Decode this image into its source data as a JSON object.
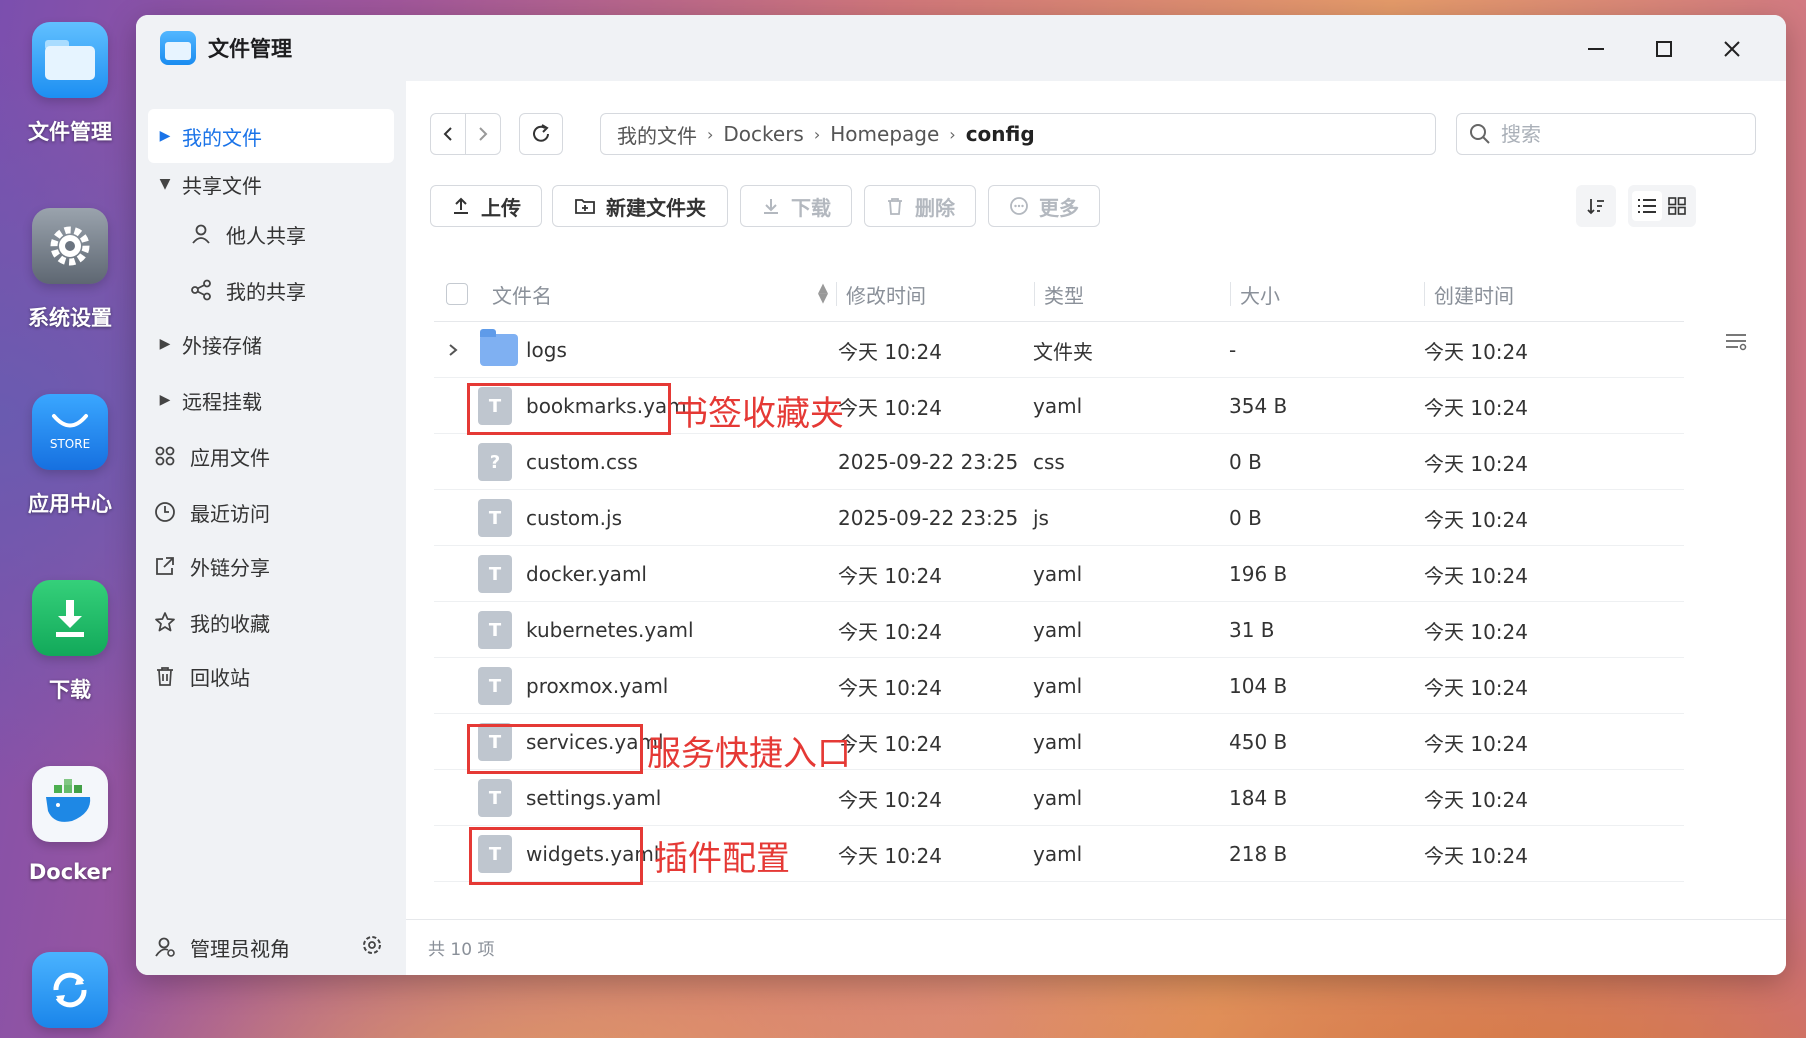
{
  "dock": {
    "apps": [
      {
        "label": "文件管理",
        "icon": "folder-icon"
      },
      {
        "label": "系统设置",
        "icon": "gear-icon"
      },
      {
        "label": "应用中心",
        "icon": "store-icon",
        "badge": "STORE"
      },
      {
        "label": "下载",
        "icon": "download-icon"
      },
      {
        "label": "Docker",
        "icon": "docker-icon"
      },
      {
        "label": "",
        "icon": "sync-icon"
      }
    ]
  },
  "window": {
    "title": "文件管理",
    "controls": [
      "minimize-icon",
      "maximize-icon",
      "close-icon"
    ]
  },
  "sidebar": {
    "items": [
      {
        "label": "我的文件",
        "icon": "caret-right-icon",
        "active": true
      },
      {
        "label": "共享文件",
        "icon": "caret-down-icon"
      },
      {
        "label": "他人共享",
        "icon": "user-icon"
      },
      {
        "label": "我的共享",
        "icon": "share-icon"
      },
      {
        "label": "外接存储",
        "icon": "caret-right-icon"
      },
      {
        "label": "远程挂载",
        "icon": "caret-right-icon"
      },
      {
        "label": "应用文件",
        "icon": "apps-grid-icon"
      },
      {
        "label": "最近访问",
        "icon": "clock-icon"
      },
      {
        "label": "外链分享",
        "icon": "external-link-icon"
      },
      {
        "label": "我的收藏",
        "icon": "star-icon"
      },
      {
        "label": "回收站",
        "icon": "trash-icon"
      }
    ],
    "footer_label": "管理员视角"
  },
  "breadcrumb": [
    "我的文件",
    "Dockers",
    "Homepage",
    "config"
  ],
  "search": {
    "placeholder": "搜索"
  },
  "toolbar": {
    "upload": "上传",
    "new_folder": "新建文件夹",
    "download": "下载",
    "delete": "删除",
    "more": "更多"
  },
  "table": {
    "headers": {
      "name": "文件名",
      "modified": "修改时间",
      "type": "类型",
      "size": "大小",
      "created": "创建时间"
    },
    "rows": [
      {
        "name": "logs",
        "kind": "folder",
        "modified": "今天 10:24",
        "type": "文件夹",
        "size": "-",
        "created": "今天 10:24"
      },
      {
        "name": "bookmarks.yaml",
        "kind": "text",
        "modified": "今天 10:24",
        "type": "yaml",
        "size": "354 B",
        "created": "今天 10:24"
      },
      {
        "name": "custom.css",
        "kind": "unknown",
        "modified": "2025-09-22 23:25",
        "type": "css",
        "size": "0 B",
        "created": "今天 10:24"
      },
      {
        "name": "custom.js",
        "kind": "text",
        "modified": "2025-09-22 23:25",
        "type": "js",
        "size": "0 B",
        "created": "今天 10:24"
      },
      {
        "name": "docker.yaml",
        "kind": "text",
        "modified": "今天 10:24",
        "type": "yaml",
        "size": "196 B",
        "created": "今天 10:24"
      },
      {
        "name": "kubernetes.yaml",
        "kind": "text",
        "modified": "今天 10:24",
        "type": "yaml",
        "size": "31 B",
        "created": "今天 10:24"
      },
      {
        "name": "proxmox.yaml",
        "kind": "text",
        "modified": "今天 10:24",
        "type": "yaml",
        "size": "104 B",
        "created": "今天 10:24"
      },
      {
        "name": "services.yaml",
        "kind": "text",
        "modified": "今天 10:24",
        "type": "yaml",
        "size": "450 B",
        "created": "今天 10:24"
      },
      {
        "name": "settings.yaml",
        "kind": "text",
        "modified": "今天 10:24",
        "type": "yaml",
        "size": "184 B",
        "created": "今天 10:24"
      },
      {
        "name": "widgets.yaml",
        "kind": "text",
        "modified": "今天 10:24",
        "type": "yaml",
        "size": "218 B",
        "created": "今天 10:24"
      }
    ]
  },
  "annotations": {
    "bookmarks": "书签收藏夹",
    "services": "服务快捷入口",
    "widgets": "插件配置",
    "color": "#e53935"
  },
  "status": "共 10 项",
  "colors": {
    "accent": "#1a73e8",
    "annotation": "#e53935"
  }
}
